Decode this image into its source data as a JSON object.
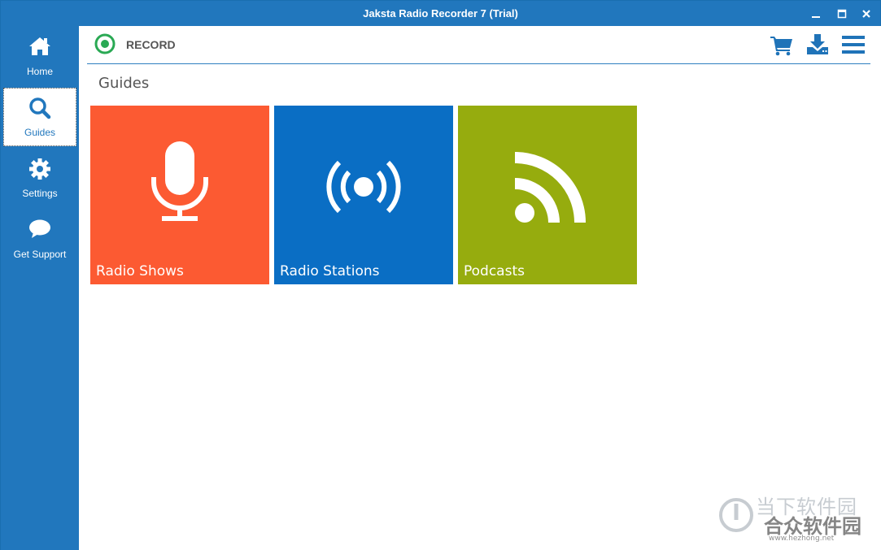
{
  "window": {
    "title": "Jaksta Radio Recorder 7 (Trial)"
  },
  "sidebar": {
    "items": [
      {
        "label": "Home",
        "icon": "home-icon",
        "active": false
      },
      {
        "label": "Guides",
        "icon": "search-icon",
        "active": true
      },
      {
        "label": "Settings",
        "icon": "gear-icon",
        "active": false
      },
      {
        "label": "Get Support",
        "icon": "chat-bubble-icon",
        "active": false
      }
    ]
  },
  "toolbar": {
    "record_label": "RECORD",
    "icons": [
      "cart-icon",
      "download-icon",
      "menu-icon"
    ]
  },
  "main": {
    "section_title": "Guides",
    "tiles": [
      {
        "label": "Radio Shows",
        "icon": "microphone-icon",
        "color": "#fc5a32"
      },
      {
        "label": "Radio Stations",
        "icon": "broadcast-icon",
        "color": "#0a6ec4"
      },
      {
        "label": "Podcasts",
        "icon": "rss-icon",
        "color": "#96ac0e"
      }
    ]
  },
  "watermark": {
    "line1": "当下软件园",
    "line2": "合众软件园",
    "line3": "www.hezhong.net"
  },
  "colors": {
    "accent": "#2177bd",
    "record_green": "#2aa954"
  }
}
